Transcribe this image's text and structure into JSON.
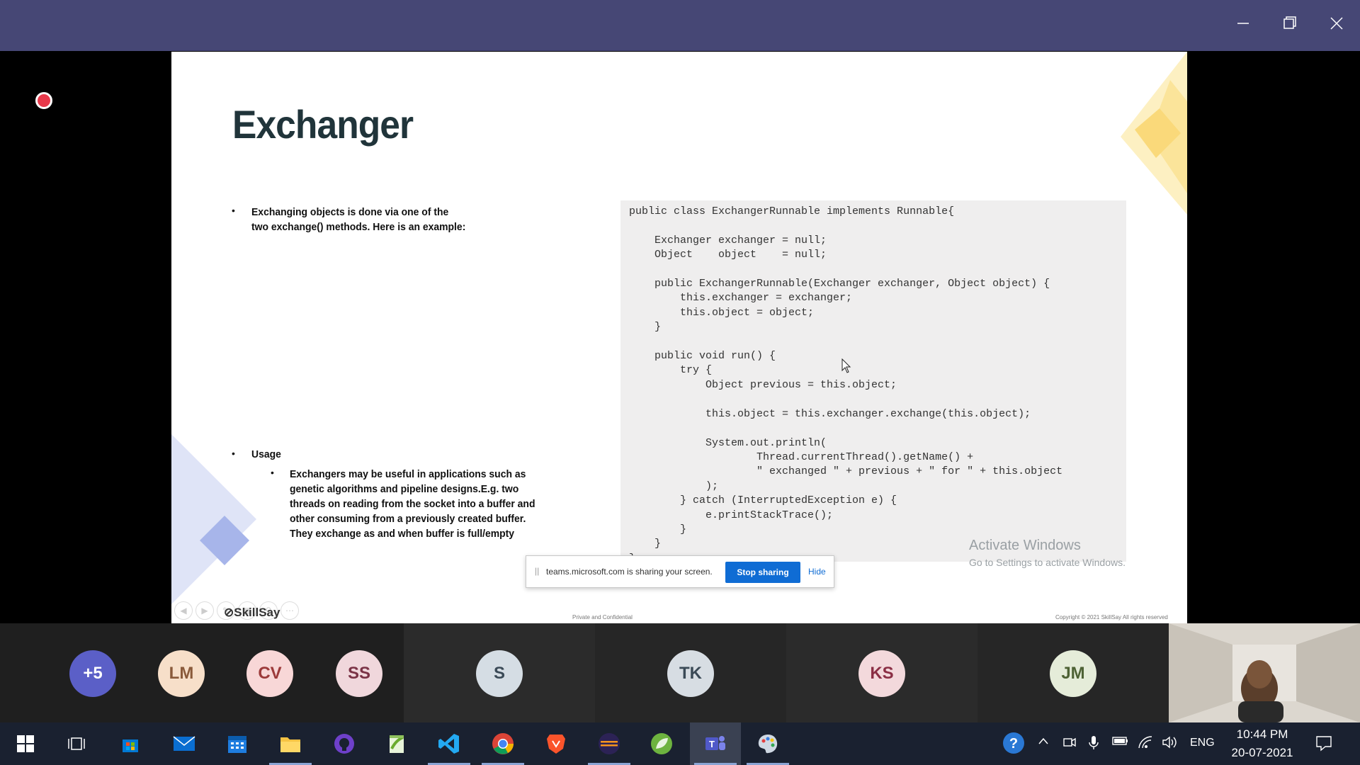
{
  "window": {
    "minimize_icon": "minimize-icon",
    "maximize_icon": "restore-icon",
    "close_icon": "close-icon"
  },
  "slide": {
    "title": "Exchanger",
    "bullet1_line1": "Exchanging objects is done via one of the",
    "bullet1_line2": "two exchange() methods. Here is an example:",
    "usage_label": "Usage",
    "usage_lines": [
      "Exchangers may be useful in applications such as",
      "genetic algorithms and pipeline designs.E.g. two",
      "threads on reading from the socket into a buffer and",
      "other consuming from a previously created buffer.",
      "They exchange as and when buffer is full/empty"
    ],
    "code": "public class ExchangerRunnable implements Runnable{\n\n    Exchanger exchanger = null;\n    Object    object    = null;\n\n    public ExchangerRunnable(Exchanger exchanger, Object object) {\n        this.exchanger = exchanger;\n        this.object = object;\n    }\n\n    public void run() {\n        try {\n            Object previous = this.object;\n\n            this.object = this.exchanger.exchange(this.object);\n\n            System.out.println(\n                    Thread.currentThread().getName() +\n                    \" exchanged \" + previous + \" for \" + this.object\n            );\n        } catch (InterruptedException e) {\n            e.printStackTrace();\n        }\n    }\n}",
    "activate_line1": "Activate Windows",
    "activate_line2": "Go to Settings to activate Windows.",
    "footer_left": "Private and Confidential",
    "footer_right": "Copyright © 2021 SkillSay All rights reserved",
    "logo": "SkillSay"
  },
  "share_banner": {
    "text": "teams.microsoft.com is sharing your screen.",
    "stop_label": "Stop sharing",
    "hide_label": "Hide"
  },
  "participants": [
    {
      "initials": "+5",
      "bg": "#5b5fc7",
      "fg": "#ffffff"
    },
    {
      "initials": "LM",
      "bg": "#f7dfc9",
      "fg": "#8a5a3a"
    },
    {
      "initials": "CV",
      "bg": "#f8d7d7",
      "fg": "#9c3a3a"
    },
    {
      "initials": "SS",
      "bg": "#f0d7dc",
      "fg": "#7a3346"
    },
    {
      "initials": "S",
      "bg": "#d5dde4",
      "fg": "#3b4a57"
    },
    {
      "initials": "TK",
      "bg": "#d7dde3",
      "fg": "#3b4a57"
    },
    {
      "initials": "KS",
      "bg": "#f3d9dc",
      "fg": "#8b2f45"
    },
    {
      "initials": "JM",
      "bg": "#e5ecd9",
      "fg": "#4e6235"
    }
  ],
  "taskbar": {
    "language": "ENG",
    "time": "10:44 PM",
    "date": "20-07-2021"
  },
  "colors": {
    "titlebar": "#464775",
    "accent": "#0f6cd4",
    "taskbar": "#1a2130"
  }
}
